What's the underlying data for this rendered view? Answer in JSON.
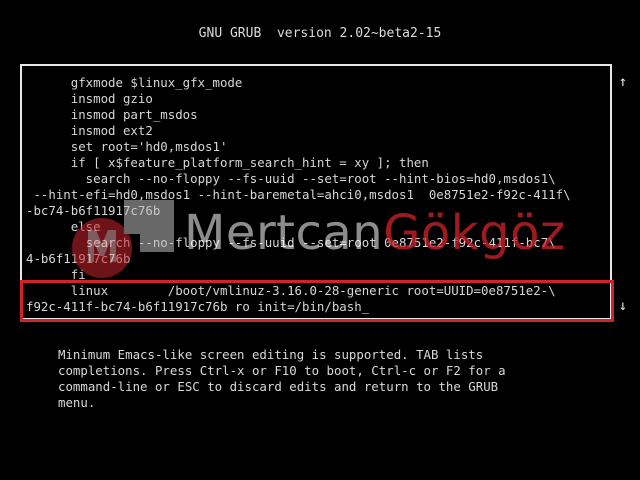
{
  "header": {
    "title": "GNU GRUB  version 2.02~beta2-15"
  },
  "editor": {
    "lines": [
      "      gfxmode $linux_gfx_mode",
      "      insmod gzio",
      "      insmod part_msdos",
      "      insmod ext2",
      "      set root='hd0,msdos1'",
      "      if [ x$feature_platform_search_hint = xy ]; then",
      "        search --no-floppy --fs-uuid --set=root --hint-bios=hd0,msdos1\\",
      " --hint-efi=hd0,msdos1 --hint-baremetal=ahci0,msdos1  0e8751e2-f92c-411f\\",
      "-bc74-b6f11917c76b",
      "      else",
      "        search --no-floppy --fs-uuid --set=root 0e8751e2-f92c-411f-bc7\\",
      "4-b6f11917c76b",
      "      fi",
      "      linux        /boot/vmlinuz-3.16.0-28-generic root=UUID=0e8751e2-\\",
      "f92c-411f-bc74-b6f11917c76b ro init=/bin/bash"
    ],
    "cursor": "_",
    "scroll_up_arrow": "↑",
    "scroll_down_arrow": "↓"
  },
  "help": {
    "lines": [
      "Minimum Emacs-like screen editing is supported. TAB lists",
      "completions. Press Ctrl-x or F10 to boot, Ctrl-c or F2 for a",
      "command-line or ESC to discard edits and return to the GRUB",
      "menu."
    ]
  },
  "watermark": {
    "text_part1": "Mertcan",
    "text_part2": "Gökgöz",
    "accent_color": "#d2232a"
  },
  "colors": {
    "background": "#000000",
    "text": "#d8d8d8",
    "highlight": "#d2232a"
  }
}
